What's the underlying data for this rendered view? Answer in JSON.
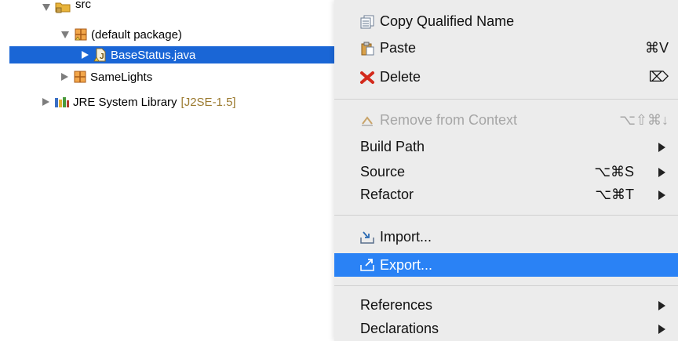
{
  "tree": {
    "items": [
      {
        "label": "src",
        "expanded": true,
        "icon": "source-folder-icon"
      },
      {
        "label": "(default package)",
        "expanded": true,
        "icon": "package-icon"
      },
      {
        "label": "BaseStatus.java",
        "expanded": false,
        "selected": true,
        "icon": "java-file-icon"
      },
      {
        "label": "SameLights",
        "expanded": false,
        "icon": "package-icon"
      },
      {
        "label": "JRE System Library",
        "decorator": "[J2SE-1.5]",
        "expanded": false,
        "icon": "library-icon"
      }
    ]
  },
  "context_menu": {
    "items": [
      {
        "label": "Copy Qualified Name",
        "icon": "copy-icon"
      },
      {
        "label": "Paste",
        "icon": "paste-icon",
        "shortcut": "⌘V"
      },
      {
        "label": "Delete",
        "icon": "delete-icon",
        "shortcut": "⌦"
      },
      {
        "label": "Remove from Context",
        "icon": "remove-context-icon",
        "shortcut": "⌥⇧⌘↓",
        "disabled": true
      },
      {
        "label": "Build Path",
        "submenu": true
      },
      {
        "label": "Source",
        "shortcut": "⌥⌘S",
        "submenu": true
      },
      {
        "label": "Refactor",
        "shortcut": "⌥⌘T",
        "submenu": true
      },
      {
        "label": "Import...",
        "icon": "import-icon"
      },
      {
        "label": "Export...",
        "icon": "export-icon",
        "highlighted": true
      },
      {
        "label": "References",
        "submenu": true
      },
      {
        "label": "Declarations",
        "submenu": true
      }
    ]
  },
  "colors": {
    "selection": "#1a66d6",
    "menu_highlight": "#2a82f5",
    "menu_background": "#ececec",
    "disabled_text": "#a6a6a6",
    "decorator": "#9b7a2f"
  }
}
